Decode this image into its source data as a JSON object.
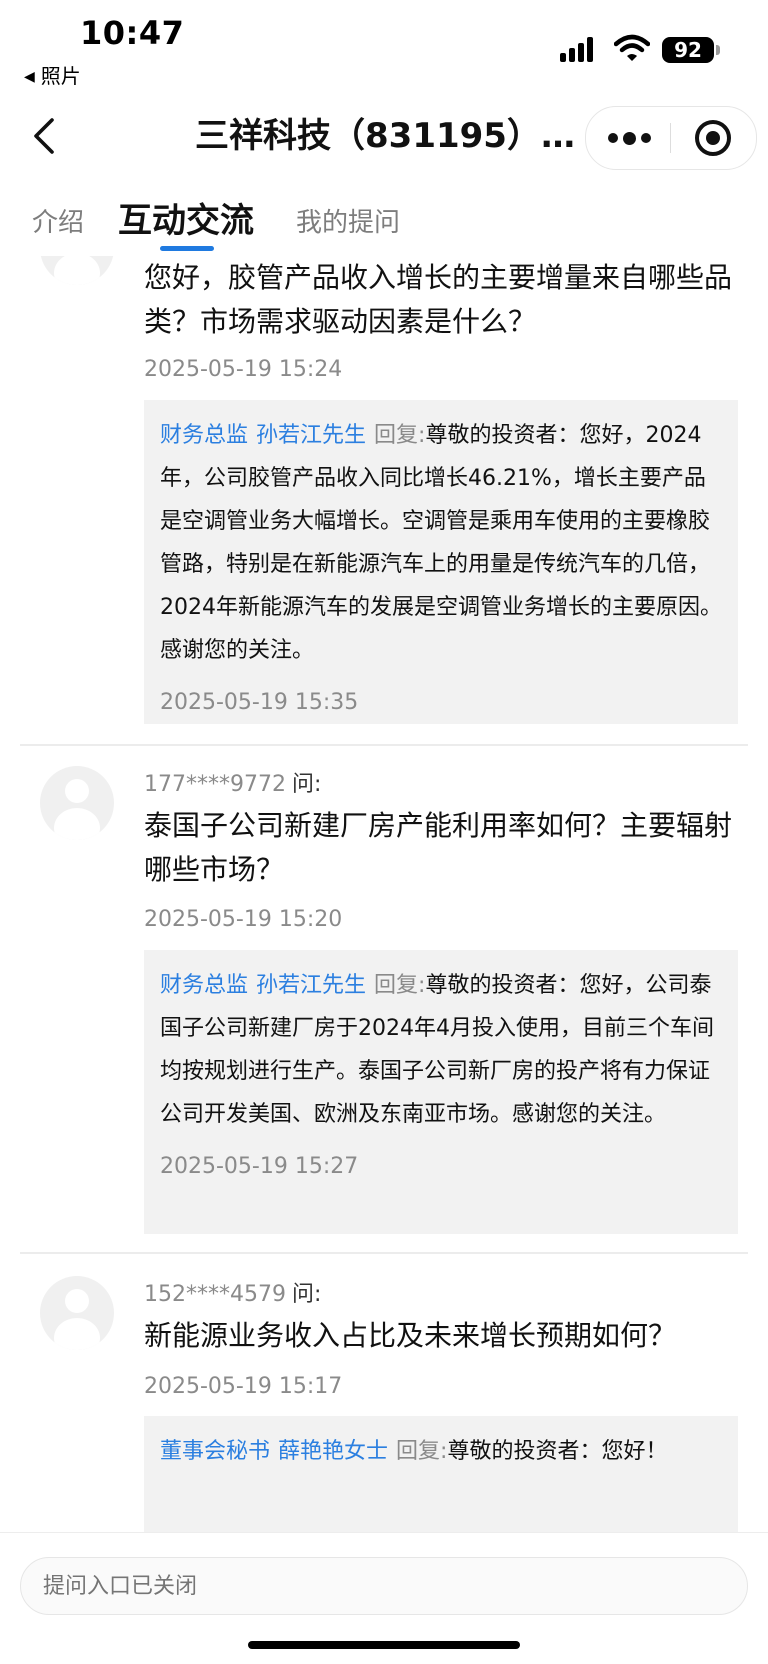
{
  "status_bar": {
    "time": "10:47",
    "back_app": "照片",
    "battery": "92"
  },
  "nav": {
    "title": "三祥科技（831195）20..."
  },
  "tabs": [
    {
      "label": "介绍",
      "active": false
    },
    {
      "label": "互动交流",
      "active": true
    },
    {
      "label": "我的提问",
      "active": false
    }
  ],
  "accent_color": "#1f7ae0",
  "link_color": "#2b7fe0",
  "ask_suffix": "问:",
  "reply_label": "回复:",
  "items": [
    {
      "asker": "",
      "question": "您好，胶管产品收入增长的主要增量来自哪些品类？市场需求驱动因素是什么？",
      "question_time": "2025-05-19 15:24",
      "reply_role": "财务总监",
      "reply_name": "孙若江先生",
      "reply": "尊敬的投资者：您好，2024年，公司胶管产品收入同比增长46.21%，增长主要产品是空调管业务大幅增长。空调管是乘用车使用的主要橡胶管路，特别是在新能源汽车上的用量是传统汽车的几倍，2024年新能源汽车的发展是空调管业务增长的主要原因。感谢您的关注。",
      "reply_time": "2025-05-19 15:35"
    },
    {
      "asker": "177****9772",
      "question": "泰国子公司新建厂房产能利用率如何？主要辐射哪些市场？",
      "question_time": "2025-05-19 15:20",
      "reply_role": "财务总监",
      "reply_name": "孙若江先生",
      "reply": "尊敬的投资者：您好，公司泰国子公司新建厂房于2024年4月投入使用，目前三个车间均按规划进行生产。泰国子公司新厂房的投产将有力保证公司开发美国、欧洲及东南亚市场。感谢您的关注。",
      "reply_time": "2025-05-19 15:27"
    },
    {
      "asker": "152****4579",
      "question": "新能源业务收入占比及未来增长预期如何？",
      "question_time": "2025-05-19 15:17",
      "reply_role": "董事会秘书",
      "reply_name": "薛艳艳女士",
      "reply": "尊敬的投资者：您好！",
      "reply_time": ""
    }
  ],
  "bottom": {
    "input_placeholder": "提问入口已关闭"
  }
}
